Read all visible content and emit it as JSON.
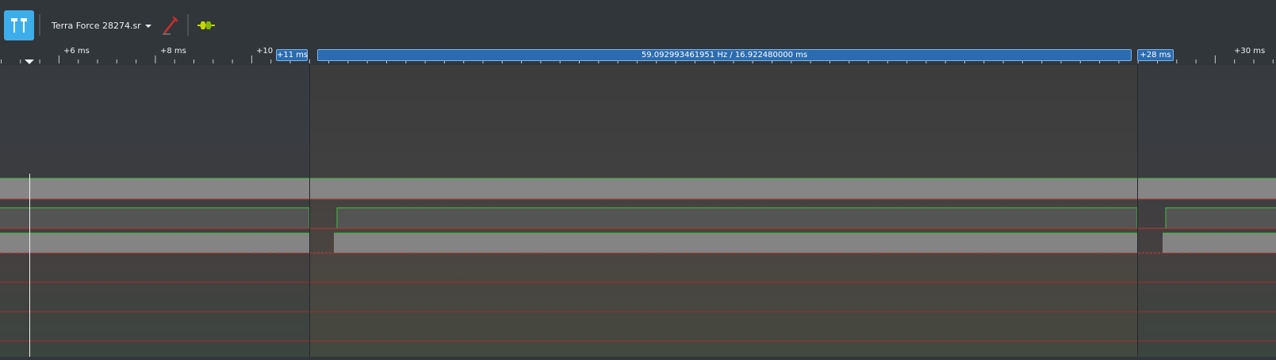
{
  "toolbar": {
    "device_name": "Terra Force 28274.sr",
    "icons": [
      "channels-icon",
      "device-dropdown-icon",
      "probe-icon",
      "decoder-icon"
    ]
  },
  "ruler": {
    "labels": [
      "+6 ms",
      "+8 ms",
      "+10",
      "+30 ms"
    ]
  },
  "cursors": {
    "left_label": "+11 ms",
    "right_label": "+28 ms",
    "measurement": "59.092993461951 Hz / 16.922480000 ms"
  },
  "colors": {
    "background": "#31363b",
    "cursor_area": "#3c3c3c",
    "accent": "#3daee9",
    "flag": "#2b6cb0",
    "high_line": "#3fbf3f",
    "low_line": "#c0392b"
  }
}
